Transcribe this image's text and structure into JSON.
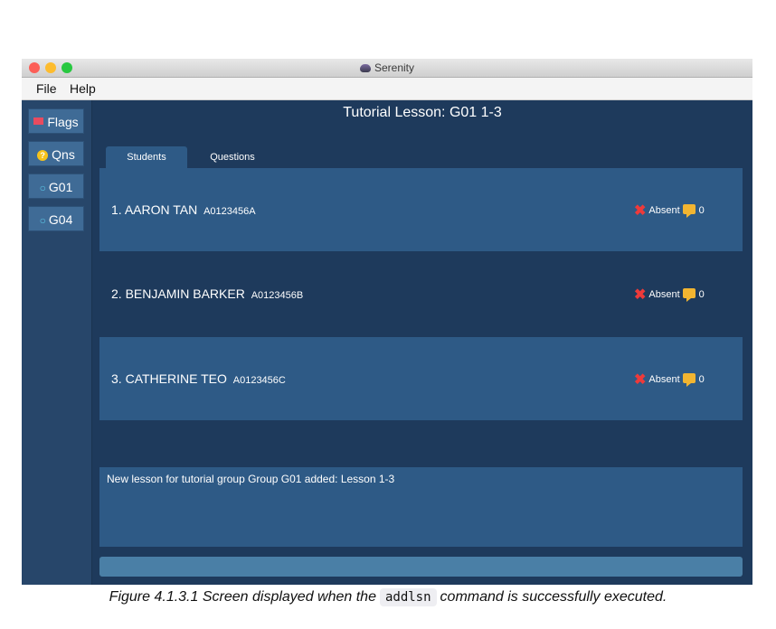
{
  "window": {
    "title": "Serenity"
  },
  "menu": {
    "items": [
      "File",
      "Help"
    ]
  },
  "sidebar": {
    "items": [
      {
        "label": "Flags",
        "icon": "flag-icon"
      },
      {
        "label": "Qns",
        "icon": "question-icon"
      },
      {
        "label": "G01",
        "icon": "person-icon"
      },
      {
        "label": "G04",
        "icon": "person-icon"
      }
    ]
  },
  "main": {
    "title": "Tutorial Lesson: G01 1-3",
    "tabs": [
      {
        "label": "Students",
        "selected": true
      },
      {
        "label": "Questions",
        "selected": false
      }
    ],
    "students": [
      {
        "index": "1.",
        "name": "AARON TAN",
        "id": "A0123456A",
        "status": "Absent",
        "count": "0"
      },
      {
        "index": "2.",
        "name": "BENJAMIN BARKER",
        "id": "A0123456B",
        "status": "Absent",
        "count": "0"
      },
      {
        "index": "3.",
        "name": "CATHERINE TEO",
        "id": "A0123456C",
        "status": "Absent",
        "count": "0"
      }
    ],
    "result_message": "New lesson for tutorial group Group G01 added: Lesson 1-3",
    "command_input": {
      "value": ""
    }
  },
  "caption": {
    "prefix": "Figure 4.1.3.1 Screen displayed when the",
    "code": "addlsn",
    "suffix": "command is successfully executed."
  },
  "colors": {
    "background": "#1e3a5c",
    "panel": "#2e5a86",
    "absent_x": "#ee3a3a",
    "comment": "#f2b531"
  }
}
